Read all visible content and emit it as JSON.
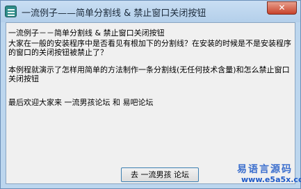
{
  "window": {
    "title": "一流例子——简单分割线 & 禁止窗口关闭按钮",
    "close_label": "✕"
  },
  "content": {
    "line_title": "一流例子－－简单分割线 & 禁止窗口关闭按钮",
    "para_1": "大家在一般的安装程序中是否看见有根加下的分割线？在安装的时候是不是安装程序的窗口的关闭按钮被禁止了？",
    "para_2": "本例程就演示了怎样用简单的方法制作一条分割线(无任何技术含量)和怎么禁止窗口关闭按钮",
    "para_3": "最后欢迎大家来  一流男孩论坛  和  易吧论坛"
  },
  "button": {
    "label": "去  一流男孩 论坛"
  },
  "watermark": {
    "top": "易语言源码",
    "bottom": "www.e5a5x.com"
  }
}
